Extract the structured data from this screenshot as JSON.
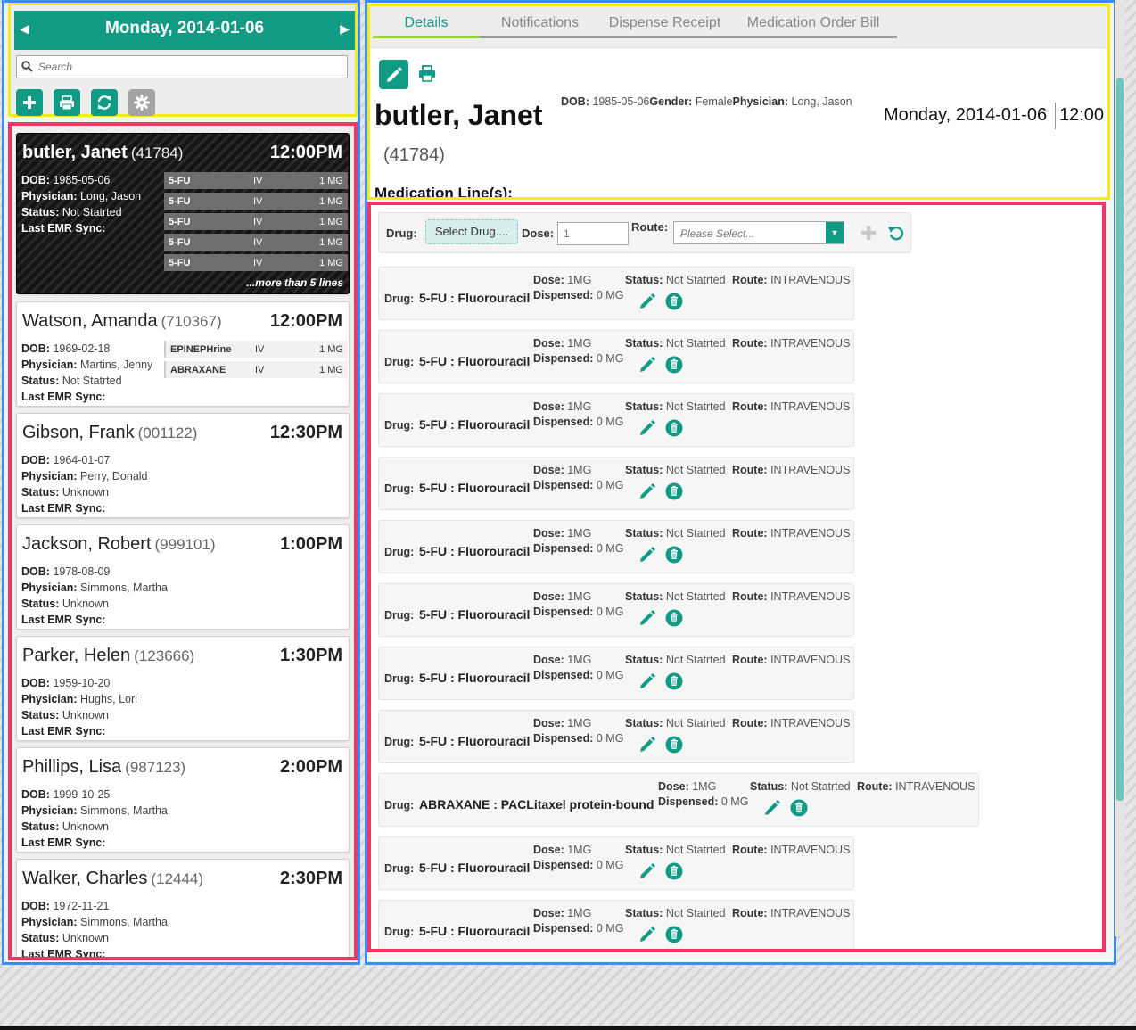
{
  "left": {
    "date": "Monday, 2014-01-06",
    "search_placeholder": "Search",
    "more_lines": "...more than 5 lines",
    "labels": {
      "dob": "DOB:",
      "physician": "Physician:",
      "status": "Status:",
      "last_sync": "Last EMR Sync:"
    }
  },
  "patients": [
    {
      "name": "butler, Janet",
      "id": "(41784)",
      "time": "12:00PM",
      "dob": "1985-05-06",
      "physician": "Long, Jason",
      "status": "Not Statrted",
      "active": true,
      "meds": [
        {
          "drug": "5-FU",
          "route": "IV",
          "dose": "1 MG"
        },
        {
          "drug": "5-FU",
          "route": "IV",
          "dose": "1 MG"
        },
        {
          "drug": "5-FU",
          "route": "IV",
          "dose": "1 MG"
        },
        {
          "drug": "5-FU",
          "route": "IV",
          "dose": "1 MG"
        },
        {
          "drug": "5-FU",
          "route": "IV",
          "dose": "1 MG"
        }
      ]
    },
    {
      "name": "Watson, Amanda",
      "id": "(710367)",
      "time": "12:00PM",
      "dob": "1969-02-18",
      "physician": "Martins, Jenny",
      "status": "Not Statrted",
      "meds": [
        {
          "drug": "EPINEPHrine",
          "route": "IV",
          "dose": "1 MG"
        },
        {
          "drug": "ABRAXANE",
          "route": "IV",
          "dose": "1 MG"
        }
      ]
    },
    {
      "name": "Gibson, Frank",
      "id": "(001122)",
      "time": "12:30PM",
      "dob": "1964-01-07",
      "physician": "Perry, Donald",
      "status": "Unknown",
      "meds": []
    },
    {
      "name": "Jackson, Robert",
      "id": "(999101)",
      "time": "1:00PM",
      "dob": "1978-08-09",
      "physician": "Simmons, Martha",
      "status": "Unknown",
      "meds": []
    },
    {
      "name": "Parker, Helen",
      "id": "(123666)",
      "time": "1:30PM",
      "dob": "1959-10-20",
      "physician": "Hughs, Lori",
      "status": "Unknown",
      "meds": []
    },
    {
      "name": "Phillips, Lisa",
      "id": "(987123)",
      "time": "2:00PM",
      "dob": "1999-10-25",
      "physician": "Simmons, Martha",
      "status": "Unknown",
      "meds": []
    },
    {
      "name": "Walker, Charles",
      "id": "(12444)",
      "time": "2:30PM",
      "dob": "1972-11-21",
      "physician": "Simmons, Martha",
      "status": "Unknown",
      "meds": []
    }
  ],
  "right": {
    "tabs": [
      "Details",
      "Notifications",
      "Dispense Receipt",
      "Medication Order Bill"
    ],
    "patient_name": "butler, Janet",
    "patient_id": "(41784)",
    "dob_label": "DOB:",
    "dob": "1985-05-06",
    "gender_label": "Gender:",
    "gender": "Female",
    "physician_label": "Physician:",
    "physician": "Long, Jason",
    "date": "Monday, 2014-01-06",
    "time": "12:00",
    "med_lines_heading": "Medication Line(s):"
  },
  "add_form": {
    "drug_label": "Drug:",
    "select_drug": "Select Drug....",
    "dose_label": "Dose:",
    "dose_value": "1",
    "route_label": "Route:",
    "route_placeholder": "Please Select..."
  },
  "med_labels": {
    "drug": "Drug:",
    "dose": "Dose:",
    "dispensed": "Dispensed:",
    "status": "Status:",
    "route": "Route:"
  },
  "med_lines": [
    {
      "drug": "5-FU : Fluorouracil",
      "dose": "1MG",
      "dispensed": "0 MG",
      "status": "Not Statrted",
      "route": "INTRAVENOUS"
    },
    {
      "drug": "5-FU : Fluorouracil",
      "dose": "1MG",
      "dispensed": "0 MG",
      "status": "Not Statrted",
      "route": "INTRAVENOUS"
    },
    {
      "drug": "5-FU : Fluorouracil",
      "dose": "1MG",
      "dispensed": "0 MG",
      "status": "Not Statrted",
      "route": "INTRAVENOUS"
    },
    {
      "drug": "5-FU : Fluorouracil",
      "dose": "1MG",
      "dispensed": "0 MG",
      "status": "Not Statrted",
      "route": "INTRAVENOUS"
    },
    {
      "drug": "5-FU : Fluorouracil",
      "dose": "1MG",
      "dispensed": "0 MG",
      "status": "Not Statrted",
      "route": "INTRAVENOUS"
    },
    {
      "drug": "5-FU : Fluorouracil",
      "dose": "1MG",
      "dispensed": "0 MG",
      "status": "Not Statrted",
      "route": "INTRAVENOUS"
    },
    {
      "drug": "5-FU : Fluorouracil",
      "dose": "1MG",
      "dispensed": "0 MG",
      "status": "Not Statrted",
      "route": "INTRAVENOUS"
    },
    {
      "drug": "5-FU : Fluorouracil",
      "dose": "1MG",
      "dispensed": "0 MG",
      "status": "Not Statrted",
      "route": "INTRAVENOUS"
    },
    {
      "drug": "ABRAXANE : PACLitaxel protein-bound",
      "dose": "1MG",
      "dispensed": "0 MG",
      "status": "Not Statrted",
      "route": "INTRAVENOUS",
      "wide": true
    },
    {
      "drug": "5-FU : Fluorouracil",
      "dose": "1MG",
      "dispensed": "0 MG",
      "status": "Not Statrted",
      "route": "INTRAVENOUS"
    },
    {
      "drug": "5-FU : Fluorouracil",
      "dose": "1MG",
      "dispensed": "0 MG",
      "status": "Not Statrted",
      "route": "INTRAVENOUS"
    }
  ],
  "colors": {
    "accent": "#119b84",
    "active_tab_underline": "#97d12a"
  }
}
